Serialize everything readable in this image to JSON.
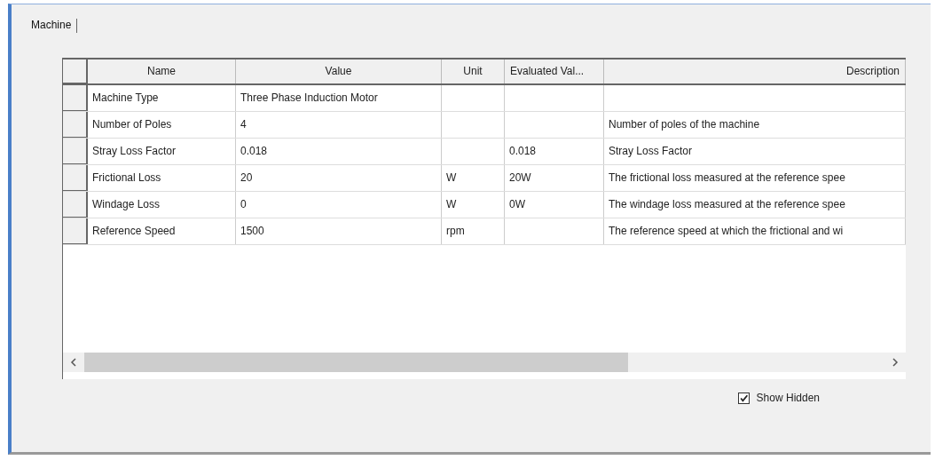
{
  "tabs": [
    {
      "label": "Machine",
      "selected": true
    }
  ],
  "table": {
    "columns": [
      "Name",
      "Value",
      "Unit",
      "Evaluated Val...",
      "Description"
    ],
    "rows": [
      {
        "cells": [
          "Machine Type",
          "Three Phase Induction Motor",
          "",
          "",
          ""
        ]
      },
      {
        "cells": [
          "Number of Poles",
          "4",
          "",
          "",
          "Number of poles of the machine"
        ]
      },
      {
        "cells": [
          "Stray Loss Factor",
          "0.018",
          "",
          "0.018",
          "Stray Loss Factor"
        ]
      },
      {
        "cells": [
          "Frictional Loss",
          "20",
          "W",
          "20W",
          "The frictional loss measured at the reference spee"
        ]
      },
      {
        "cells": [
          "Windage Loss",
          "0",
          "W",
          "0W",
          "The windage loss measured at the reference spee"
        ]
      },
      {
        "cells": [
          "Reference Speed",
          "1500",
          "rpm",
          "",
          "The reference speed at which the frictional and wi"
        ]
      }
    ]
  },
  "show_hidden": {
    "label": "Show Hidden",
    "checked": true
  }
}
